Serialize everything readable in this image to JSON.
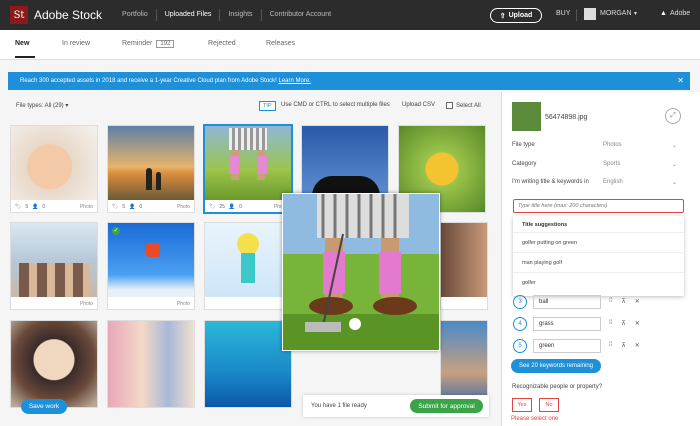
{
  "topbar": {
    "logo": "St",
    "brand": "Adobe Stock",
    "nav": [
      "Portfolio",
      "Uploaded Files",
      "Insights",
      "Contributor Account"
    ],
    "upload": "Upload",
    "buy": "BUY",
    "user": "MORGAN",
    "adobe": "Adobe"
  },
  "tabs": {
    "new": "New",
    "in_review": "In review",
    "reminder": "Reminder",
    "reminder_count": "192",
    "rejected": "Rejected",
    "releases": "Releases"
  },
  "banner": {
    "text": "Reach 300 accepted assets in 2018 and receive a 1-year Creative Cloud plan from Adobe Stock!",
    "link": "Learn More."
  },
  "toolbar": {
    "file_types": "File types: All (29)",
    "tip": "TIP",
    "tip_text": "Use CMD or CTRL to select multiple files",
    "upload_csv": "Upload CSV",
    "select_all": "Select All"
  },
  "thumbs": [
    {
      "keywords": "5",
      "people": "0",
      "kind": "Photo"
    },
    {
      "keywords": "5",
      "people": "0",
      "kind": "Photo"
    },
    {
      "keywords": "25",
      "people": "0",
      "kind": "Photo"
    },
    {
      "keywords": "",
      "people": "",
      "kind": ""
    },
    {
      "keywords": "",
      "people": "",
      "kind": ""
    },
    {
      "keywords": "",
      "people": "",
      "kind": "Photo"
    },
    {
      "keywords": "",
      "people": "",
      "kind": "Photo"
    },
    {
      "keywords": "",
      "people": "",
      "kind": ""
    }
  ],
  "bottom": {
    "save_work": "Save work",
    "ready": "You have 1 file ready",
    "submit": "Submit for approval"
  },
  "panel": {
    "filename": "56474898.jpg",
    "file_type_label": "File type",
    "file_type_val": "Photos",
    "category_label": "Category",
    "category_val": "Sports",
    "language_label": "I'm writing title & keywords in",
    "language_val": "English",
    "title_placeholder": "Type title here (max: 200 characters)",
    "suggestions_header": "Title suggestions",
    "suggestions": [
      "golfer putting on green",
      "man playing golf",
      "golfer"
    ],
    "keywords": [
      {
        "num": "3",
        "text": "ball"
      },
      {
        "num": "4",
        "text": "grass"
      },
      {
        "num": "5",
        "text": "green"
      }
    ],
    "see_keywords": "See 20 keywords remaining",
    "recognizable": "Recognizable people or property?",
    "yes": "Yes",
    "no": "No",
    "select_one": "Please select one"
  },
  "colors": {
    "accent": "#1e8fd9",
    "success": "#3aa548",
    "error": "#e04545",
    "topbar": "#2c2c2c"
  }
}
